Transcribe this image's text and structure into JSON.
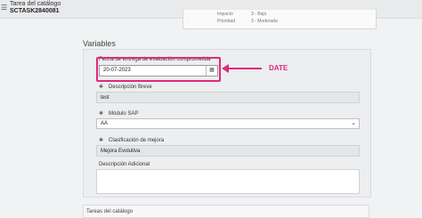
{
  "header": {
    "title": "Tarea del catálogo",
    "number": "SCTASK2840081"
  },
  "summary": {
    "impact_label": "Impacto",
    "impact_value": "3 - Bajo",
    "priority_label": "Prioridad",
    "priority_value": "3 - Moderada"
  },
  "variables": {
    "section_title": "Variables",
    "fields": {
      "date_label": "Fecha de entrega de evaluación comprometida",
      "date_value": "20-07-2023",
      "brief_label": "Descripción Breve",
      "brief_value": "test",
      "module_label": "Módulo SAP",
      "module_value": "AA",
      "classification_label": "Clasificación de mejora",
      "classification_value": "Mejora Evolutiva",
      "additional_label": "Descripción Adicional"
    },
    "mandatory_marker": "✱"
  },
  "annotation": {
    "label": "DATE",
    "color": "#e0297b"
  },
  "footer": {
    "catalog_tasks_label": "Tareas del catálogo"
  },
  "icons": {
    "menu": "hamburger-icon",
    "calendar": "calendar-icon",
    "dropdown": "chevron-down-icon"
  }
}
